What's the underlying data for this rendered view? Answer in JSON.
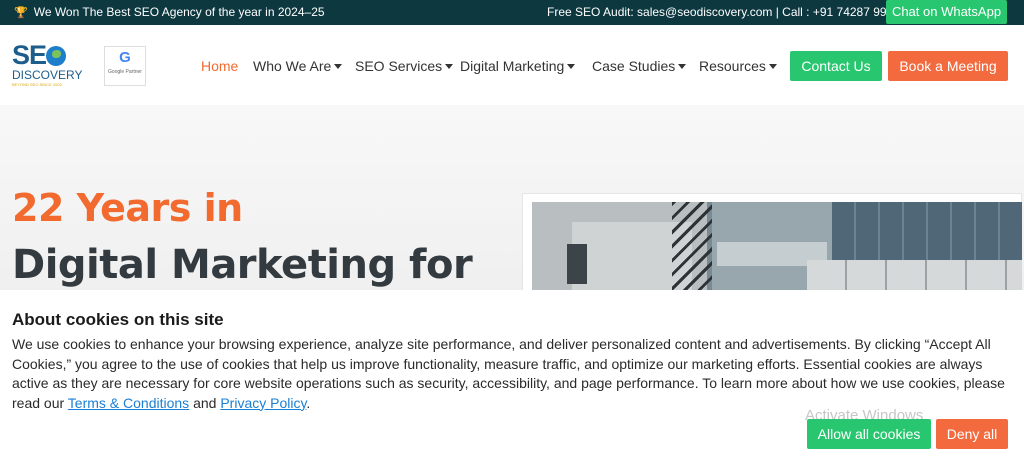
{
  "topbar": {
    "award_text": "We Won The Best SEO Agency of the year in 2024–25",
    "award_icon": "trophy-icon",
    "contact_text": "Free SEO Audit: sales@seodiscovery.com | Call : +91 74287 99334",
    "whatsapp_label": "Chat on WhatsApp"
  },
  "logo": {
    "text_seo": "SE",
    "text_discovery": "DISCOVERY",
    "tagline": "BEYOND SEO SINCE 2002",
    "partner_badge": "Google Partner",
    "partner_glyph": "G"
  },
  "nav": {
    "items": [
      {
        "label": "Home",
        "active": true,
        "dropdown": false
      },
      {
        "label": "Who We Are",
        "active": false,
        "dropdown": true
      },
      {
        "label": "SEO Services",
        "active": false,
        "dropdown": true
      },
      {
        "label": "Digital Marketing",
        "active": false,
        "dropdown": true
      },
      {
        "label": "Case Studies",
        "active": false,
        "dropdown": true
      },
      {
        "label": "Resources",
        "active": false,
        "dropdown": true
      }
    ],
    "contact_label": "Contact Us",
    "meeting_label": "Book a Meeting"
  },
  "hero": {
    "line1": "22 Years in",
    "line2": "Digital Marketing for"
  },
  "cookie": {
    "title": "About cookies on this site",
    "body": "We use cookies to enhance your browsing experience, analyze site performance, and deliver personalized content and advertisements. By clicking “Accept All Cookies,” you agree to the use of cookies that help us improve functionality, measure traffic, and optimize our marketing efforts. Essential cookies are always active as they are necessary for core website operations such as security, accessibility, and page performance. To learn more about how we use cookies, please read our",
    "terms_link": "Terms & Conditions",
    "and_text": "and",
    "privacy_link": "Privacy Policy",
    "end_text": ".",
    "allow_label": "Allow all cookies",
    "deny_label": "Deny all"
  },
  "watermark": "Activate Windows",
  "colors": {
    "topbar_bg": "#0d3840",
    "accent_orange": "#f26a2e",
    "accent_green": "#28c76f",
    "link_blue": "#1a7fd4"
  }
}
